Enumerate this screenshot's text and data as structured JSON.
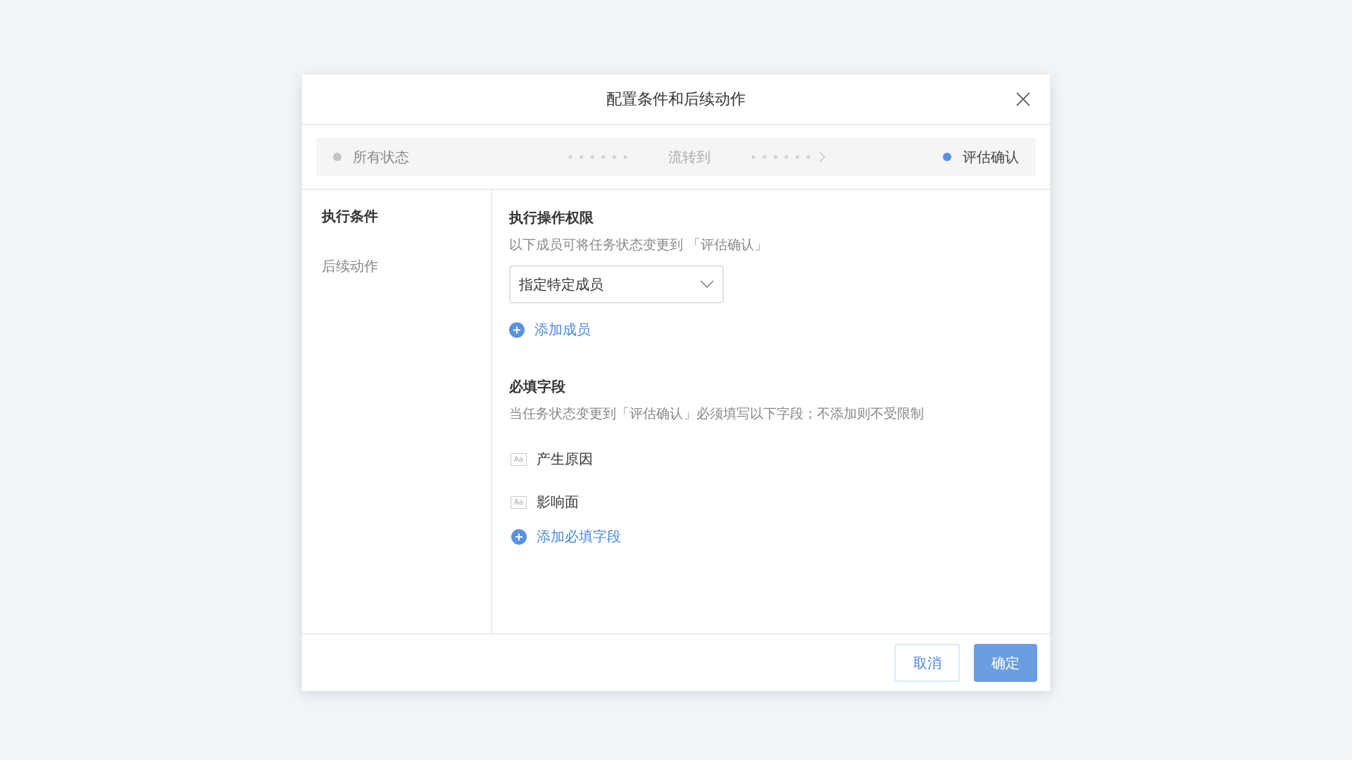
{
  "dialog": {
    "title": "配置条件和后续动作"
  },
  "flow": {
    "from": {
      "label": "所有状态",
      "color": "#c4c4c4"
    },
    "via": "流转到",
    "to": {
      "label": "评估确认",
      "color": "#5b92e0"
    }
  },
  "sidebar": {
    "items": [
      {
        "label": "执行条件",
        "selected": true
      },
      {
        "label": "后续动作",
        "selected": false
      }
    ]
  },
  "permissions": {
    "title": "执行操作权限",
    "description": "以下成员可将任务状态变更到 「评估确认」",
    "select": {
      "value": "指定特定成员"
    },
    "add_link": "添加成员"
  },
  "required_fields": {
    "title": "必填字段",
    "description": "当任务状态变更到「评估确认」必须填写以下字段；不添加则不受限制",
    "fields": [
      {
        "icon_text": "Aa",
        "label": "产生原因"
      },
      {
        "icon_text": "Aa",
        "label": "影响面"
      }
    ],
    "add_link": "添加必填字段"
  },
  "buttons": [
    {
      "label": "取消",
      "kind": "secondary"
    },
    {
      "label": "确定",
      "kind": "primary"
    }
  ]
}
